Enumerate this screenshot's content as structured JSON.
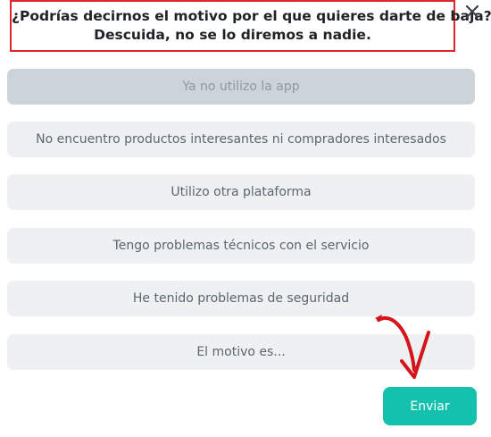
{
  "dialog": {
    "title_line1": "¿Podrías decirnos el motivo por el que quieres darte de baja?",
    "title_line2": "Descuida, no se lo diremos a nadie.",
    "close_icon": "close-icon"
  },
  "options": [
    {
      "label": "Ya no utilizo la app",
      "selected": true
    },
    {
      "label": "No encuentro productos interesantes ni compradores interesados",
      "selected": false
    },
    {
      "label": "Utilizo otra plataforma",
      "selected": false
    },
    {
      "label": "Tengo problemas técnicos con el servicio",
      "selected": false
    },
    {
      "label": "He tenido problemas de seguridad",
      "selected": false
    },
    {
      "label": "El motivo es...",
      "selected": false
    }
  ],
  "send_button": {
    "label": "Enviar"
  },
  "colors": {
    "highlight_border": "#e0242b",
    "accent": "#13c1ac",
    "option_bg": "#eef0f2",
    "option_selected_bg": "#cdd4d9",
    "annotation_arrow": "#d4161c"
  }
}
